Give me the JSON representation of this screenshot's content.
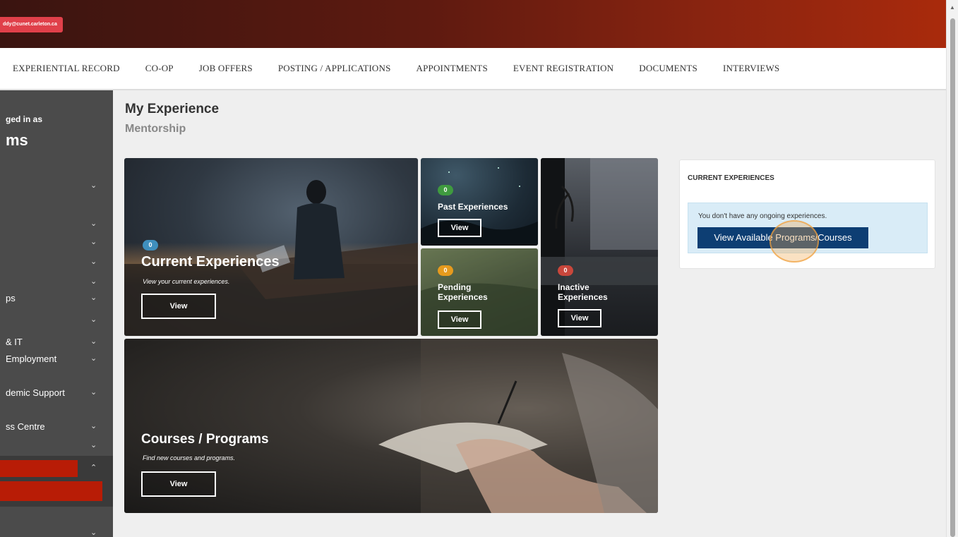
{
  "header": {
    "user_email": "ddy@cunet.carleton.ca"
  },
  "nav": {
    "items": [
      "EXPERIENTIAL RECORD",
      "CO-OP",
      "JOB OFFERS",
      "POSTING / APPLICATIONS",
      "APPOINTMENTS",
      "EVENT REGISTRATION",
      "DOCUMENTS",
      "INTERVIEWS"
    ]
  },
  "sidebar": {
    "logged_label": "ged in as",
    "logged_name": "ms",
    "items": [
      {
        "label": "",
        "chevron": "⌄"
      },
      {
        "label": "",
        "chevron": "⌄"
      },
      {
        "label": "",
        "chevron": "⌄"
      },
      {
        "label": "",
        "chevron": "⌄"
      },
      {
        "label": "",
        "chevron": "⌄"
      },
      {
        "label": "ps",
        "chevron": "⌄"
      },
      {
        "label": "",
        "chevron": "⌄"
      },
      {
        "label": "& IT",
        "chevron": "⌄"
      },
      {
        "label": "Employment",
        "chevron": "⌄"
      },
      {
        "label": "demic Support",
        "chevron": "⌄"
      },
      {
        "label": "ss Centre",
        "chevron": "⌄"
      },
      {
        "label": "",
        "chevron": "⌄"
      },
      {
        "label": "",
        "chevron": "⌃"
      },
      {
        "label": "",
        "chevron": "⌄"
      }
    ]
  },
  "main": {
    "title": "My Experience",
    "subtitle": "Mentorship",
    "tiles": {
      "current": {
        "count": "0",
        "title": "Current Experiences",
        "desc": "View your current experiences.",
        "button": "View"
      },
      "past": {
        "count": "0",
        "title": "Past Experiences",
        "button": "View"
      },
      "pending": {
        "count": "0",
        "title_line1": "Pending",
        "title_line2": "Experiences",
        "button": "View"
      },
      "inactive": {
        "count": "0",
        "title_line1": "Inactive",
        "title_line2": "Experiences",
        "button": "View"
      },
      "courses": {
        "title": "Courses / Programs",
        "desc": "Find new courses and programs.",
        "button": "View"
      }
    }
  },
  "side_card": {
    "title": "CURRENT EXPERIENCES",
    "message": "You don't have any ongoing experiences.",
    "button": "View Available Programs/Courses"
  },
  "colors": {
    "accent_red": "#b81c06",
    "primary_button": "#0d3e73",
    "alert_bg": "#d9ecf7"
  }
}
